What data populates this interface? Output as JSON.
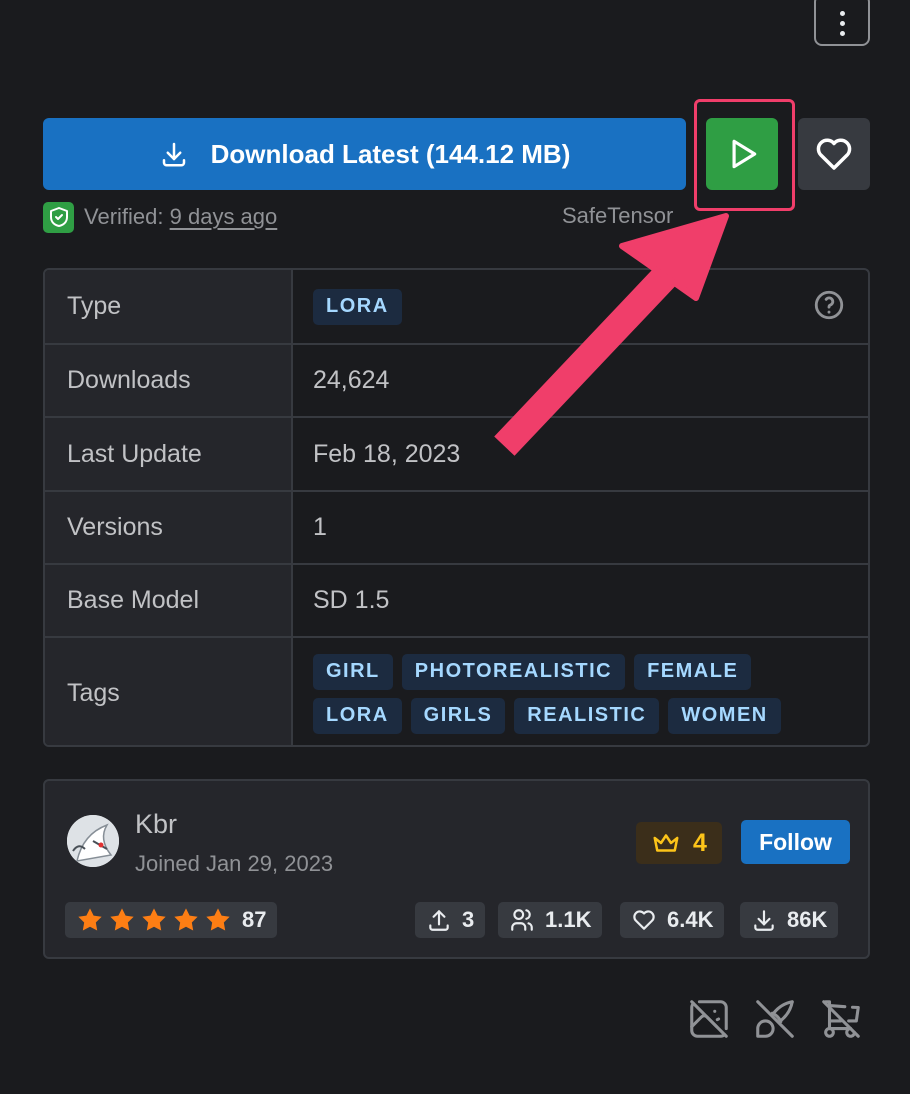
{
  "download": {
    "label": "Download Latest (144.12 MB)"
  },
  "verified": {
    "prefix": "Verified:",
    "when": "9 days ago",
    "format": "SafeTensor"
  },
  "details": {
    "type": {
      "label": "Type",
      "value": "LORA"
    },
    "downloads": {
      "label": "Downloads",
      "value": "24,624"
    },
    "last_update": {
      "label": "Last Update",
      "value": "Feb 18, 2023"
    },
    "versions": {
      "label": "Versions",
      "value": "1"
    },
    "base_model": {
      "label": "Base Model",
      "value": "SD 1.5"
    },
    "tags": {
      "label": "Tags",
      "values": [
        "GIRL",
        "PHOTOREALISTIC",
        "FEMALE",
        "LORA",
        "GIRLS",
        "REALISTIC",
        "WOMEN"
      ]
    }
  },
  "creator": {
    "name": "Kbr",
    "joined": "Joined Jan 29, 2023",
    "rank": "4",
    "follow_label": "Follow",
    "rating": 5,
    "rating_count": "87",
    "stats": {
      "uploads": "3",
      "followers": "1.1K",
      "favorites": "6.4K",
      "downloads": "86K"
    }
  },
  "icons": [
    "kebab-menu-icon",
    "download-icon",
    "play-icon",
    "heart-icon",
    "shield-check-icon",
    "help-icon",
    "crown-icon",
    "star-icon",
    "upload-icon",
    "users-icon",
    "download-icon",
    "photo-off-icon",
    "brush-off-icon",
    "shopping-cart-off-icon"
  ],
  "colors": {
    "primary": "#1971c2",
    "run": "#2f9e44",
    "annotation": "#f03e6a",
    "badge_text": "#a5d8ff",
    "star": "#fd7e14",
    "crown": "#fcc419"
  }
}
